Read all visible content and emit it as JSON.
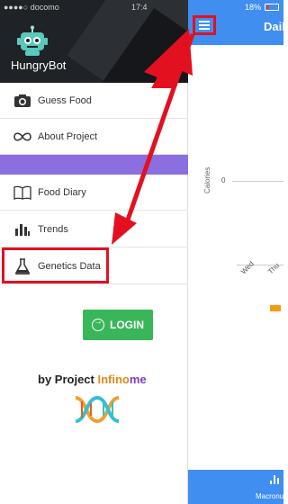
{
  "status_bar": {
    "carrier": "docomo",
    "time": "17:4",
    "battery": "18%"
  },
  "app": {
    "title": "Dail",
    "y_axis_label": "Calories",
    "zero_label": "0",
    "x_ticks": [
      "Wed",
      "Thu"
    ],
    "bottom_tab_label": "Macronu"
  },
  "drawer": {
    "brand": "HungryBot",
    "items": [
      {
        "label": "Guess Food",
        "icon": "camera-icon"
      },
      {
        "label": "About Project",
        "icon": "infinity-icon"
      },
      {
        "label": "Food Diary",
        "icon": "book-icon"
      },
      {
        "label": "Trends",
        "icon": "bar-chart-icon"
      },
      {
        "label": "Genetics Data",
        "icon": "flask-icon"
      }
    ],
    "login_label": "LOGIN",
    "footer_prefix": "by Project ",
    "footer_part1": "Infino",
    "footer_part2": "me"
  },
  "colors": {
    "header_blue": "#3f8ef0",
    "drawer_header": "#1f2226",
    "accent_purple": "#8b6ee0",
    "login_green": "#39b659",
    "annotation_red": "#e3101f"
  }
}
